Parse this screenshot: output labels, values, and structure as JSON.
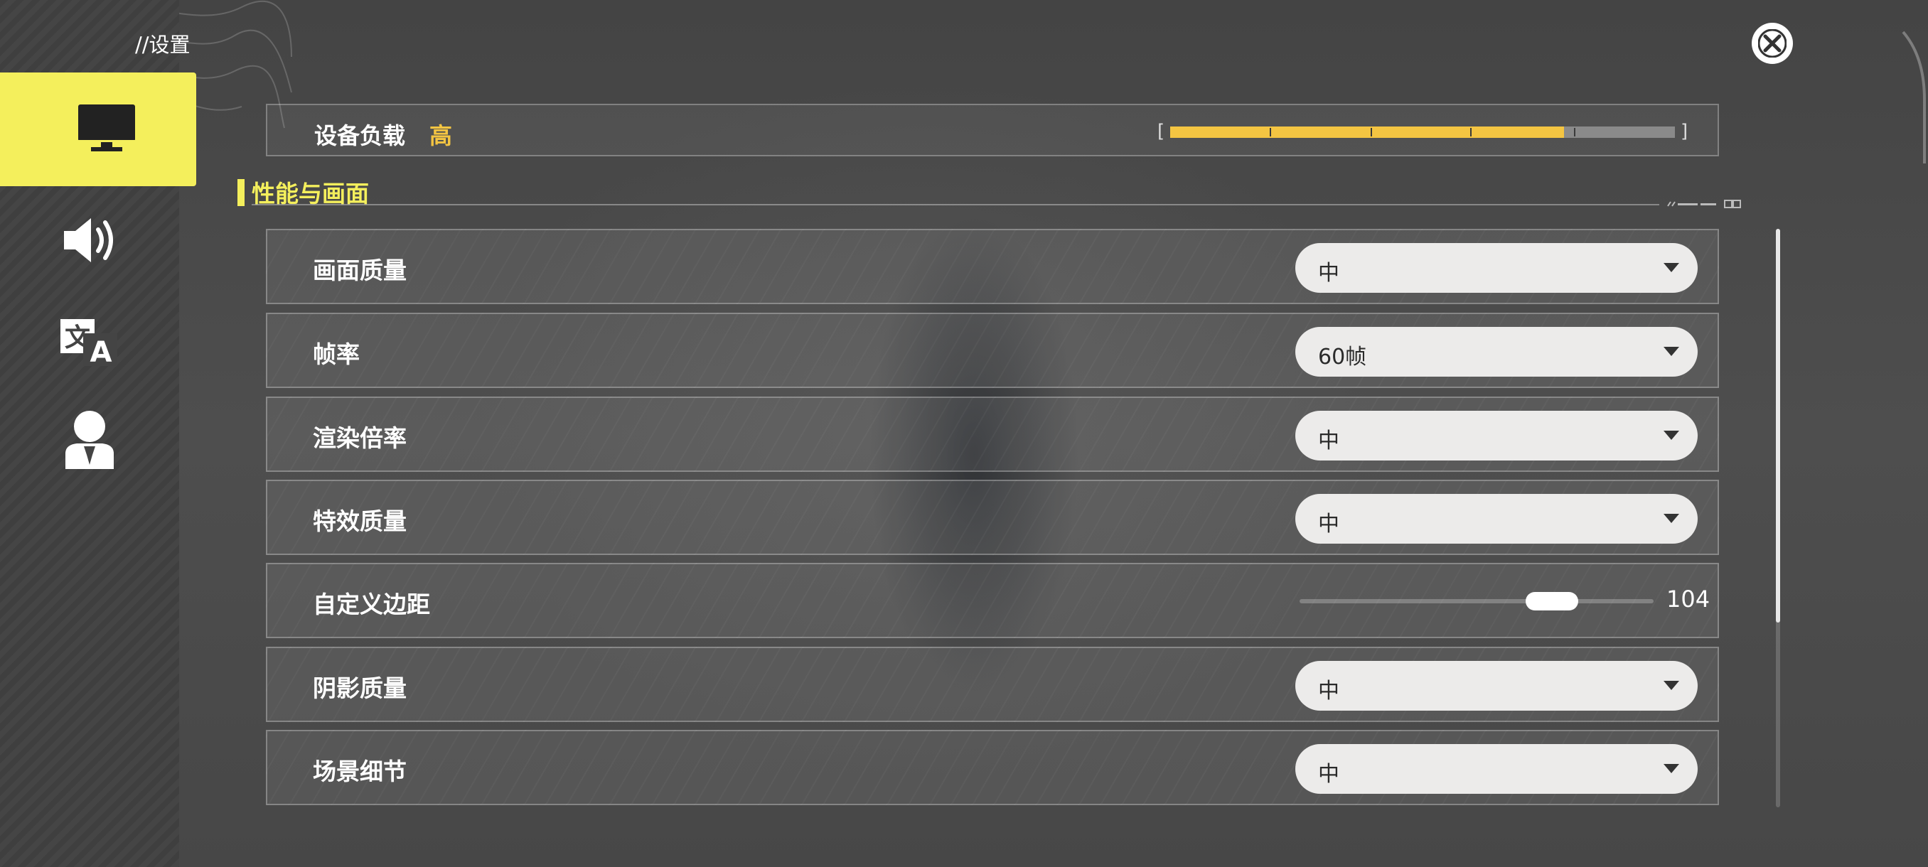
{
  "header": {
    "breadcrumb": "//设置",
    "close_icon": "close-icon"
  },
  "sidebar": {
    "items": [
      {
        "id": "display",
        "icon": "monitor-icon",
        "active": true
      },
      {
        "id": "audio",
        "icon": "speaker-icon",
        "active": false
      },
      {
        "id": "language",
        "icon": "translate-icon",
        "active": false
      },
      {
        "id": "account",
        "icon": "user-icon",
        "active": false
      }
    ]
  },
  "device_load": {
    "label": "设备负载",
    "value": "高",
    "level": 0.78,
    "color": "#f4c542"
  },
  "section": {
    "title": "性能与画面",
    "accent_color": "#f4ef5c"
  },
  "settings": [
    {
      "label": "画面质量",
      "type": "dropdown",
      "value": "中"
    },
    {
      "label": "帧率",
      "type": "dropdown",
      "value": "60帧"
    },
    {
      "label": "渲染倍率",
      "type": "dropdown",
      "value": "中"
    },
    {
      "label": "特效质量",
      "type": "dropdown",
      "value": "中"
    },
    {
      "label": "自定义边距",
      "type": "slider",
      "value": "104",
      "level": 0.75
    },
    {
      "label": "阴影质量",
      "type": "dropdown",
      "value": "中"
    },
    {
      "label": "场景细节",
      "type": "dropdown",
      "value": "中"
    }
  ],
  "scroll": {
    "level": 0.68
  }
}
